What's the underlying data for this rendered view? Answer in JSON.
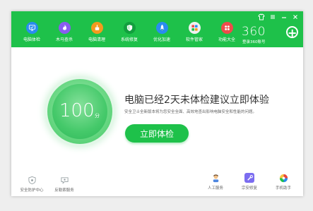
{
  "titlebar": {
    "controls": [
      "shirt-icon",
      "menu-icon",
      "minimize-icon",
      "close-icon"
    ]
  },
  "nav": {
    "items": [
      {
        "label": "电脑体检",
        "icon": "monitor-check-icon",
        "color": "#2a8cf0"
      },
      {
        "label": "木马查杀",
        "icon": "flame-icon",
        "color": "#8a5cf0"
      },
      {
        "label": "电脑清理",
        "icon": "broom-icon",
        "color": "#f39a1e"
      },
      {
        "label": "系统修复",
        "icon": "shield-icon",
        "color": "#129f3e"
      },
      {
        "label": "优化加速",
        "icon": "rocket-icon",
        "color": "#2a8cf0"
      },
      {
        "label": "软件管家",
        "icon": "software-grid-icon",
        "color": "#f0f0f0"
      },
      {
        "label": "功能大全",
        "icon": "apps-icon",
        "color": "#ef4b4b"
      }
    ]
  },
  "brand": {
    "logo": "360",
    "login": "登录360账号"
  },
  "main": {
    "score": "100",
    "score_unit": "分",
    "headline": "电脑已经2天未体检建议立即体验",
    "subline": "安全卫士全新版本将为您安全全面、高效地查出影响电脑安全和性能的问题。",
    "cta": "立即体检"
  },
  "footer": {
    "left": [
      {
        "label": "安全防护中心",
        "icon": "shield-eye-icon"
      },
      {
        "label": "反勒索服务",
        "icon": "chat-shield-icon"
      }
    ],
    "right": [
      {
        "label": "人工服务",
        "icon": "person-service-icon"
      },
      {
        "label": "宗安修复",
        "icon": "repair-tool-icon"
      },
      {
        "label": "手机助手",
        "icon": "phone-assistant-icon"
      }
    ]
  }
}
